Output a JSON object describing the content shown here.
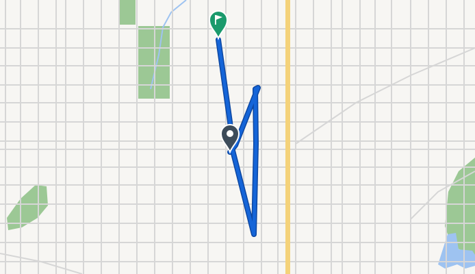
{
  "map": {
    "colors": {
      "background": "#f7f6f3",
      "street": "#d6d6d6",
      "highway": "#f4d27a",
      "park": "#8cc084",
      "water": "#9ec3f1",
      "route": "#1565d8",
      "start_marker": "#3d4c5a",
      "end_marker": "#1a9a6c"
    },
    "markers": {
      "start": {
        "icon": "location-pin-icon"
      },
      "end": {
        "icon": "flag-pin-icon"
      }
    }
  }
}
